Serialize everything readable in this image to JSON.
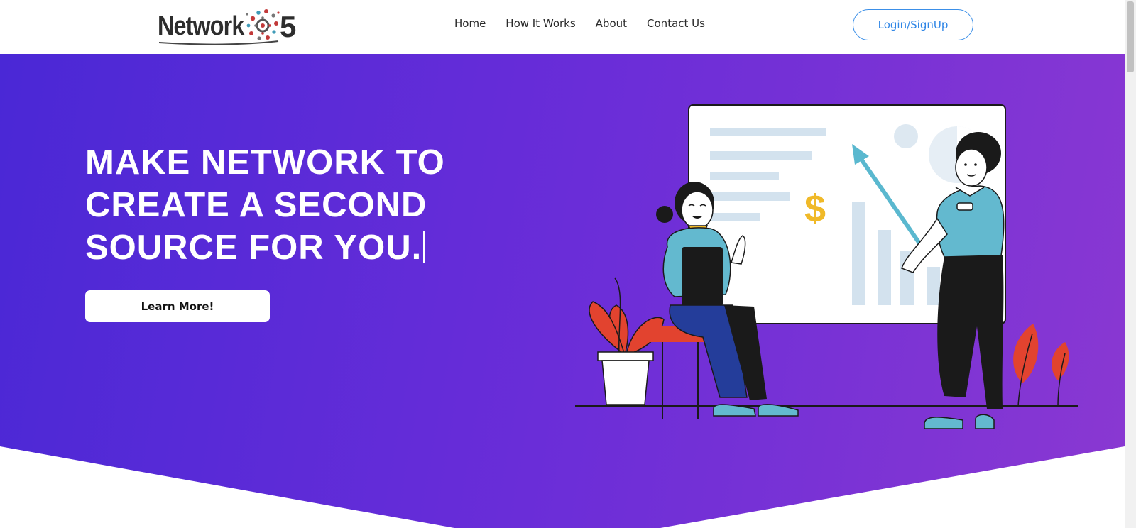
{
  "nav": {
    "logo_text": "Network",
    "logo_number": "5",
    "links": [
      "Home",
      "How It Works",
      "About",
      "Contact Us"
    ],
    "login_label": "Login/SignUp"
  },
  "hero": {
    "headline_lines": [
      "MAKE NETWORK TO",
      "CREATE A SECOND",
      "SOURCE FOR YOU."
    ],
    "cta_label": "Learn More!",
    "gradient_from": "#4a28d6",
    "gradient_to": "#8a38d2"
  },
  "illustration": {
    "currency_symbol": "$"
  },
  "colors": {
    "accent_blue": "#2f86e6",
    "plant_red": "#e2432f",
    "shirt_teal": "#63b9cf",
    "gold": "#f0b928"
  }
}
